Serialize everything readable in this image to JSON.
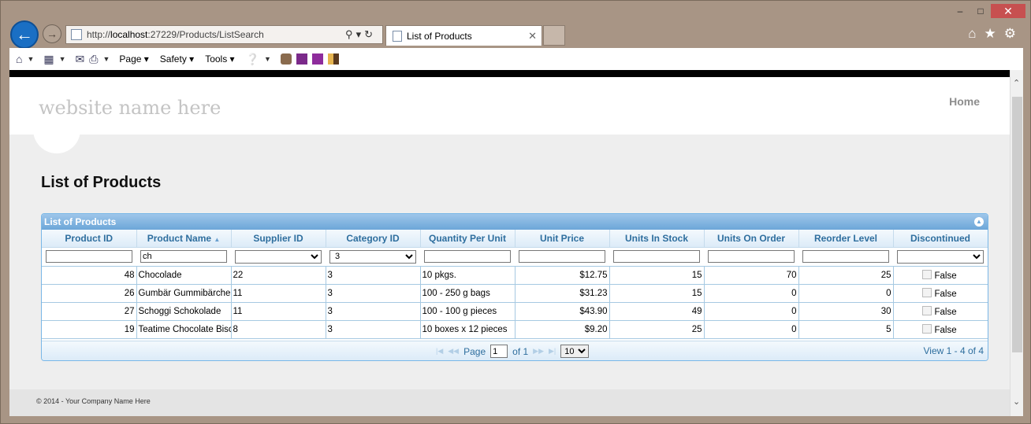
{
  "browser": {
    "url_prefix": "http://",
    "url_host": "localhost",
    "url_rest": ":27229/Products/ListSearch",
    "tab_title": "List of Products",
    "menus": [
      "Page",
      "Safety",
      "Tools"
    ]
  },
  "site": {
    "name": "website name here",
    "nav_home": "Home",
    "page_title": "List of Products",
    "footer": "© 2014 - Your Company Name Here"
  },
  "grid": {
    "caption": "List of Products",
    "columns": [
      "Product ID",
      "Product Name",
      "Supplier ID",
      "Category ID",
      "Quantity Per Unit",
      "Unit Price",
      "Units In Stock",
      "Units On Order",
      "Reorder Level",
      "Discontinued"
    ],
    "filters": {
      "product_name": "ch",
      "category_id": "3"
    },
    "rows": [
      {
        "id": "48",
        "name": "Chocolade",
        "supplier": "22",
        "category": "3",
        "qty": "10 pkgs.",
        "price": "$12.75",
        "stock": "15",
        "order": "70",
        "reorder": "25",
        "disc": "False"
      },
      {
        "id": "26",
        "name": "Gumbär Gummibärchen",
        "supplier": "11",
        "category": "3",
        "qty": "100 - 250 g bags",
        "price": "$31.23",
        "stock": "15",
        "order": "0",
        "reorder": "0",
        "disc": "False"
      },
      {
        "id": "27",
        "name": "Schoggi Schokolade",
        "supplier": "11",
        "category": "3",
        "qty": "100 - 100 g pieces",
        "price": "$43.90",
        "stock": "49",
        "order": "0",
        "reorder": "30",
        "disc": "False"
      },
      {
        "id": "19",
        "name": "Teatime Chocolate Biscuits",
        "supplier": "8",
        "category": "3",
        "qty": "10 boxes x 12 pieces",
        "price": "$9.20",
        "stock": "25",
        "order": "0",
        "reorder": "5",
        "disc": "False"
      }
    ],
    "pager": {
      "page_label": "Page",
      "page_value": "1",
      "of_label": "of 1",
      "page_size": "10",
      "view_text": "View 1 - 4 of 4"
    }
  }
}
